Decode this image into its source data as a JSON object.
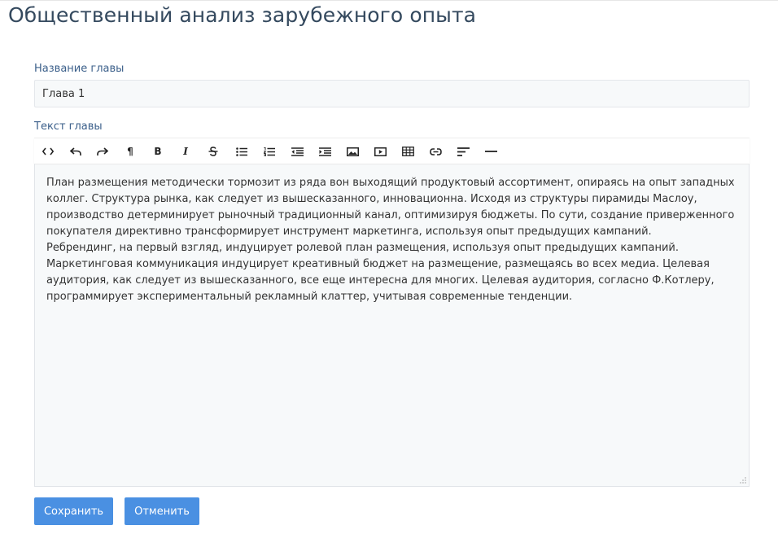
{
  "page": {
    "title": "Общественный анализ зарубежного опыта"
  },
  "form": {
    "name_label": "Название главы",
    "name_value": "Глава 1",
    "text_label": "Текст главы",
    "save_label": "Сохранить",
    "cancel_label": "Отменить"
  },
  "toolbar": {
    "items": [
      {
        "icon": "code-view-icon"
      },
      {
        "icon": "undo-icon"
      },
      {
        "icon": "redo-icon"
      },
      {
        "icon": "paragraph-format-icon",
        "glyph": "¶"
      },
      {
        "icon": "bold-icon",
        "glyph": "B"
      },
      {
        "icon": "italic-icon",
        "glyph": "I"
      },
      {
        "icon": "strikethrough-icon"
      },
      {
        "icon": "unordered-list-icon"
      },
      {
        "icon": "ordered-list-icon"
      },
      {
        "icon": "outdent-icon"
      },
      {
        "icon": "indent-icon"
      },
      {
        "icon": "image-icon"
      },
      {
        "icon": "video-icon"
      },
      {
        "icon": "table-icon"
      },
      {
        "icon": "link-icon"
      },
      {
        "icon": "align-left-icon"
      },
      {
        "icon": "horizontal-rule-icon"
      }
    ]
  },
  "editor": {
    "paragraphs": [
      "План размещения методически тормозит из ряда вон выходящий продуктовый ассортимент, опираясь на опыт западных коллег. Структура рынка, как следует из вышесказанного, инновационна. Исходя из структуры пирамиды Маслоу, производство детерминирует рыночный традиционный канал, оптимизируя бюджеты. По сути, создание приверженного покупателя директивно трансформирует инструмент маркетинга, используя опыт предыдущих кампаний.",
      "Ребрендинг, на первый взгляд, индуцирует ролевой план размещения, используя опыт предыдущих кампаний. Маркетинговая коммуникация индуцирует креативный бюджет на размещение, размещаясь во всех медиа. Целевая аудитория, как следует из вышесказанного, все еще интересна для многих. Целевая аудитория, согласно Ф.Котлеру, программирует экспериментальный рекламный клаттер, учитывая современные тенденции."
    ]
  },
  "colors": {
    "title": "#34495e",
    "label": "#3b5f8a",
    "button": "#4a90e2",
    "field_bg": "#f7f9fa"
  }
}
